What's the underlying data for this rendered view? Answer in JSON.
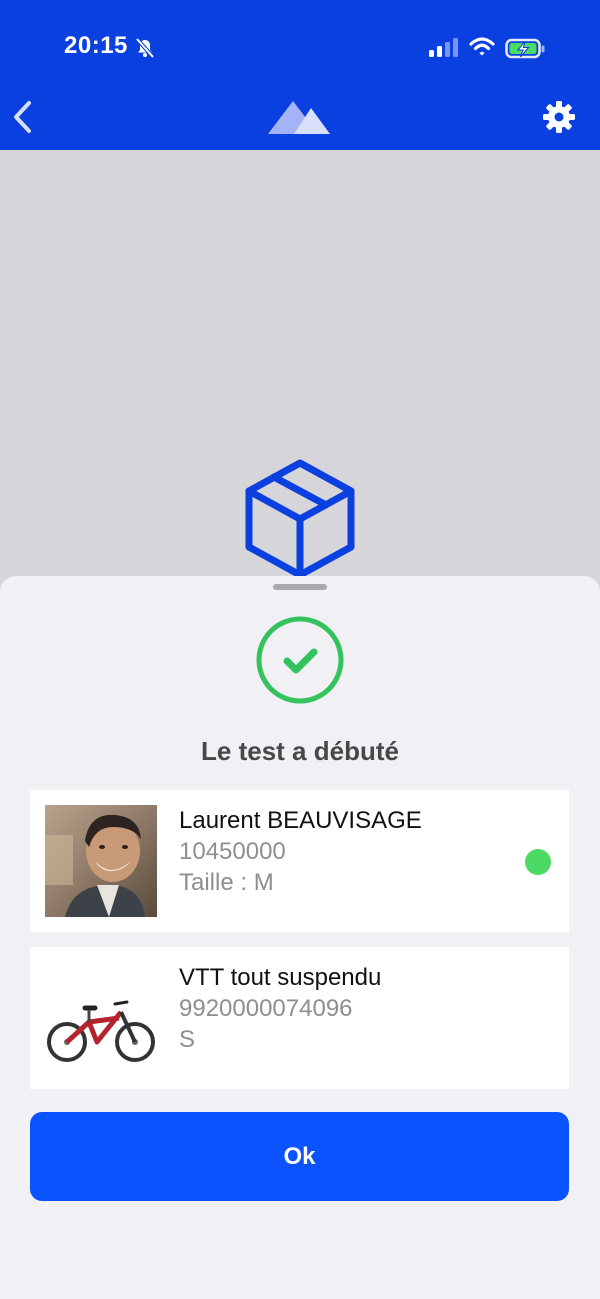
{
  "status_bar": {
    "time": "20:15"
  },
  "icons": {
    "bell_muted": "bell-slash-icon",
    "signal": "cellular-signal-icon",
    "wifi": "wifi-icon",
    "battery": "battery-charging-icon",
    "back": "chevron-left-icon",
    "logo": "mountain-logo-icon",
    "settings": "gear-icon",
    "package": "box-icon",
    "success": "checkmark-circle-icon"
  },
  "sheet": {
    "title": "Le test a débuté"
  },
  "person": {
    "name": "Laurent BEAUVISAGE",
    "id": "10450000",
    "size": "Taille : M",
    "status": "online"
  },
  "bike": {
    "name": "VTT tout suspendu",
    "code": "9920000074096",
    "size": "S"
  },
  "ok_label": "Ok",
  "colors": {
    "header": "#0a3fe0",
    "button": "#0b53ff",
    "success_green": "#33c25b",
    "status_dot": "#4cd964",
    "box_outline": "#0a3fe0"
  }
}
